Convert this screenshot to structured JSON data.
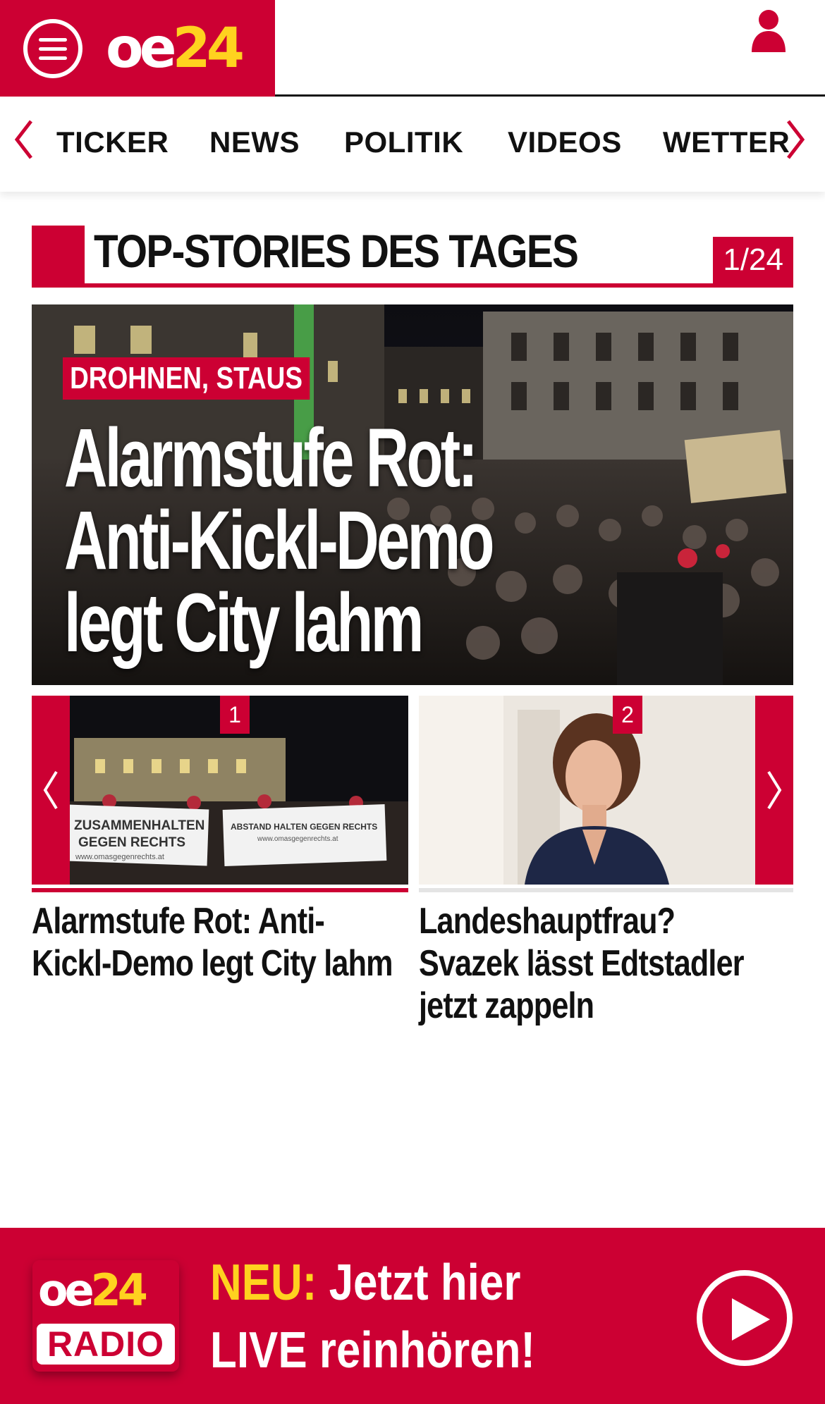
{
  "header": {
    "logo_oe": "oe",
    "logo_num": "24",
    "menu_icon": "hamburger-menu-icon",
    "user_icon": "user-icon"
  },
  "nav": {
    "items": [
      {
        "label": "TICKER"
      },
      {
        "label": "NEWS"
      },
      {
        "label": "POLITIK"
      },
      {
        "label": "VIDEOS"
      },
      {
        "label": "WETTER"
      }
    ]
  },
  "section": {
    "title": "TOP-STORIES DES TAGES",
    "counter": "1/24"
  },
  "hero": {
    "kicker": "DROHNEN, STAUS",
    "title": "Alarmstufe Rot:\nAnti-Kickl-Demo\nlegt City lahm"
  },
  "teasers": [
    {
      "number": "1",
      "title": "Alarmstufe Rot: Anti-Kickl-Demo legt City lahm",
      "banner_left": "ZUSAMMENHALTEN GEGEN RECHTS",
      "banner_left_url": "www.omasgegenrechts.at",
      "banner_right": "ABSTAND HALTEN GEGEN RECHTS",
      "banner_right_url": "www.omasgegenrechts.at"
    },
    {
      "number": "2",
      "title": "Landeshauptfrau? Svazek lässt Edtstadler jetzt zappeln"
    }
  ],
  "radio": {
    "logo_oe": "oe",
    "logo_num": "24",
    "logo_label": "RADIO",
    "neu": "NEU:",
    "line1": "Jetzt hier",
    "line2": "LIVE reinhören!"
  },
  "colors": {
    "brand_red": "#cc0033",
    "logo_yellow": "#ffd21f"
  }
}
